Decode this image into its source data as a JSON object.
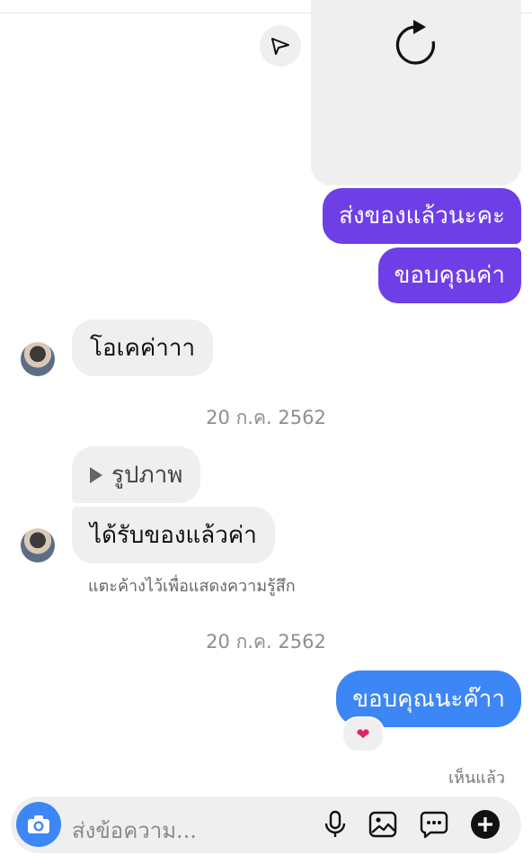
{
  "thread": {
    "outgoing_1": "ส่งของแล้วนะคะ",
    "outgoing_2": "ขอบคุณค่า",
    "incoming_1": "โอเคค่าาา",
    "date_1": "20 ก.ค. 2562",
    "incoming_photo_label": "รูปภาพ",
    "incoming_2": "ได้รับของแล้วค่า",
    "hint": "แตะค้างไว้เพื่อแสดงความรู้สึก",
    "date_2": "20 ก.ค. 2562",
    "outgoing_3": "ขอบคุณนะค๊าา",
    "reaction": "❤",
    "seen_label": "เห็นแล้ว"
  },
  "composer": {
    "placeholder": "ส่งข้อความ..."
  },
  "icons": {
    "share": "send-icon",
    "reload": "refresh-icon",
    "camera": "camera-icon",
    "mic": "microphone-icon",
    "gallery": "image-icon",
    "sticker": "chat-dots-icon",
    "more": "plus-circle-icon"
  },
  "colors": {
    "outgoing_purple": "#6e3fe7",
    "outgoing_blue": "#3d86f6",
    "incoming_bg": "#efefef"
  }
}
